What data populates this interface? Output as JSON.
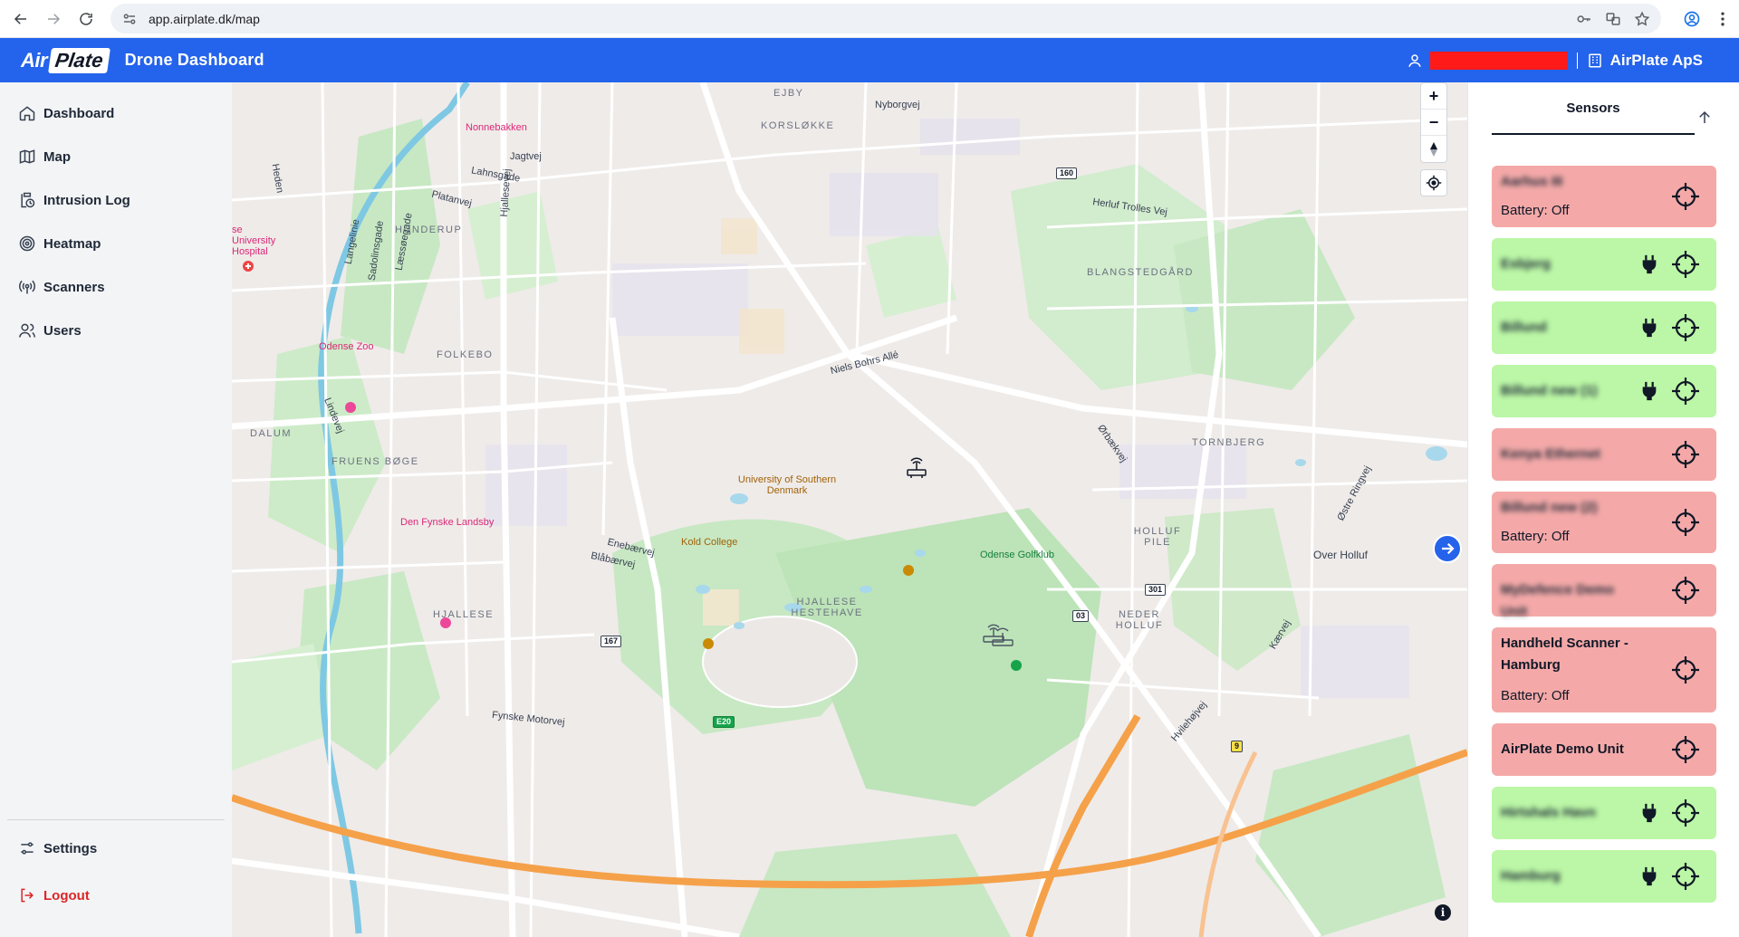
{
  "browser": {
    "url": "app.airplate.dk/map",
    "back_icon": "arrow-left-icon",
    "forward_icon": "arrow-right-icon",
    "reload_icon": "reload-icon"
  },
  "header": {
    "logo_air": "Air",
    "logo_plate": "Plate",
    "title": "Drone Dashboard",
    "company": "AirPlate ApS",
    "accent_color": "#2463eb"
  },
  "sidebar": {
    "items": [
      {
        "label": "Dashboard",
        "icon": "home-icon"
      },
      {
        "label": "Map",
        "icon": "map-icon"
      },
      {
        "label": "Intrusion Log",
        "icon": "log-icon"
      },
      {
        "label": "Heatmap",
        "icon": "heatmap-icon"
      },
      {
        "label": "Scanners",
        "icon": "scanner-icon"
      },
      {
        "label": "Users",
        "icon": "users-icon"
      }
    ],
    "settings": "Settings",
    "logout": "Logout"
  },
  "map": {
    "areas": [
      "EJBY",
      "KORSLØKKE",
      "HUNDERUP",
      "BLANGSTEDGÅRD",
      "FOLKEBO",
      "DALUM",
      "FRUENS BØGE",
      "TORNBJERG",
      "HOLLUF PILE",
      "HJALLESE",
      "HJALLESE HESTEHAVE",
      "NEDER HOLLUF"
    ],
    "streets": [
      "Nyborgvej",
      "Jagtvej",
      "Lahnsgade",
      "Platanvej",
      "Heden",
      "Langelinie",
      "Sadolinsgade",
      "Læssøegade",
      "Hjallesevej",
      "Herluf Trolles Vej",
      "Niels Bohrs Allé",
      "Lindevej",
      "Ørbækvej",
      "Østre Ringvej",
      "Enebærvej",
      "Blåbærvej",
      "Fynske Motorvej",
      "Hvilehøjvej",
      "Kærvej",
      "Over Holluf"
    ],
    "pois": {
      "nonnebakken": "Nonnebakken",
      "hospital": "se University Hospital",
      "zoo": "Odense Zoo",
      "landsby": "Den Fynske Landsby",
      "university": "University of Southern Denmark",
      "kold": "Kold College",
      "golf": "Odense Golfklub"
    },
    "road_numbers": [
      "160",
      "167",
      "301",
      "03",
      "9",
      "E20"
    ],
    "zoom_in": "+",
    "zoom_out": "−",
    "info": "i"
  },
  "sensors": {
    "tab_label": "Sensors",
    "items": [
      {
        "name": "Aarhus III",
        "status": "Battery: Off",
        "state": "red",
        "plugged": false,
        "blurred": true
      },
      {
        "name": "Esbjerg",
        "status": "",
        "state": "green",
        "plugged": true,
        "blurred": true
      },
      {
        "name": "Billund",
        "status": "",
        "state": "green",
        "plugged": true,
        "blurred": true
      },
      {
        "name": "Billund new (1)",
        "status": "",
        "state": "green",
        "plugged": true,
        "blurred": true
      },
      {
        "name": "Kenya Ethernet",
        "status": "",
        "state": "red",
        "plugged": false,
        "blurred": true
      },
      {
        "name": "Billund new (2)",
        "status": "Battery: Off",
        "state": "red",
        "plugged": false,
        "blurred": true
      },
      {
        "name": "MyDefence Demo Unit",
        "status": "",
        "state": "red",
        "plugged": false,
        "blurred": true
      },
      {
        "name": "Handheld Scanner - Hamburg",
        "status": "Battery: Off",
        "state": "red",
        "plugged": false,
        "blurred": false
      },
      {
        "name": "AirPlate Demo Unit",
        "status": "",
        "state": "red",
        "plugged": false,
        "blurred": false
      },
      {
        "name": "Hirtshals Havn",
        "status": "",
        "state": "green",
        "plugged": true,
        "blurred": true
      },
      {
        "name": "Hamburg",
        "status": "",
        "state": "green",
        "plugged": true,
        "blurred": true
      }
    ]
  }
}
